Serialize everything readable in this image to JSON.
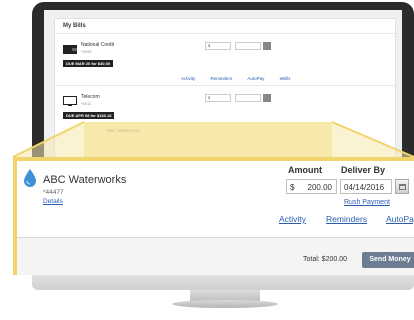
{
  "screen": {
    "title": "My Bills",
    "bills": [
      {
        "name": "National Credit",
        "account": "*8098",
        "due": "DUE MAR 20 for $40.00",
        "amount": "$",
        "icon": "wallet-icon"
      },
      {
        "name": "Telecom",
        "account": "*6611",
        "due": "DUE APR 08 for $136.18",
        "amount": "$",
        "icon": "monitor-icon"
      }
    ],
    "links": [
      "Activity",
      "Reminders",
      "AutoPay",
      "eBills"
    ],
    "faded_bill": "ABC Waterworks"
  },
  "card": {
    "biller_name": "ABC Waterworks",
    "account": "*44477",
    "details_link": "Details",
    "amount_label": "Amount",
    "currency": "$",
    "amount_value": "200.00",
    "deliver_label": "Deliver By",
    "deliver_date": "04/14/2016",
    "rush_payment": "Rush Payment",
    "links": {
      "activity": "Activity",
      "reminders": "Reminders",
      "autopay": "AutoPay"
    },
    "total": "Total: $200.00",
    "send_button": "Send Money",
    "accent_color": "#f1d56a",
    "button_color": "#6c7d93",
    "link_color": "#2a5db0"
  }
}
